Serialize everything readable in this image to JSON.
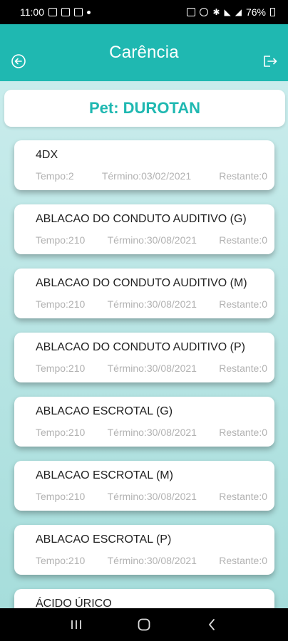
{
  "status_bar": {
    "time": "11:00",
    "battery": "76%"
  },
  "header": {
    "title": "Carência"
  },
  "pet": {
    "label": "Pet: DUROTAN"
  },
  "items": [
    {
      "name": "4DX",
      "tempo": "Tempo:2",
      "termino": "Término:03/02/2021",
      "restante": "Restante:0"
    },
    {
      "name": "ABLACAO DO CONDUTO AUDITIVO (G)",
      "tempo": "Tempo:210",
      "termino": "Término:30/08/2021",
      "restante": "Restante:0"
    },
    {
      "name": "ABLACAO DO CONDUTO AUDITIVO (M)",
      "tempo": "Tempo:210",
      "termino": "Término:30/08/2021",
      "restante": "Restante:0"
    },
    {
      "name": "ABLACAO DO CONDUTO AUDITIVO (P)",
      "tempo": "Tempo:210",
      "termino": "Término:30/08/2021",
      "restante": "Restante:0"
    },
    {
      "name": "ABLACAO ESCROTAL (G)",
      "tempo": "Tempo:210",
      "termino": "Término:30/08/2021",
      "restante": "Restante:0"
    },
    {
      "name": "ABLACAO ESCROTAL (M)",
      "tempo": "Tempo:210",
      "termino": "Término:30/08/2021",
      "restante": "Restante:0"
    },
    {
      "name": "ABLACAO ESCROTAL (P)",
      "tempo": "Tempo:210",
      "termino": "Término:30/08/2021",
      "restante": "Restante:0"
    },
    {
      "name": "ÁCIDO ÚRICO",
      "tempo": "",
      "termino": "",
      "restante": ""
    }
  ],
  "icons": {
    "back": "back-arrow-circle-icon",
    "logout": "logout-icon",
    "nav_recents": "recents-icon",
    "nav_home": "home-icon",
    "nav_back": "back-chevron-icon"
  },
  "colors": {
    "accent": "#1fb8b1",
    "background": "#b9e3e2"
  }
}
